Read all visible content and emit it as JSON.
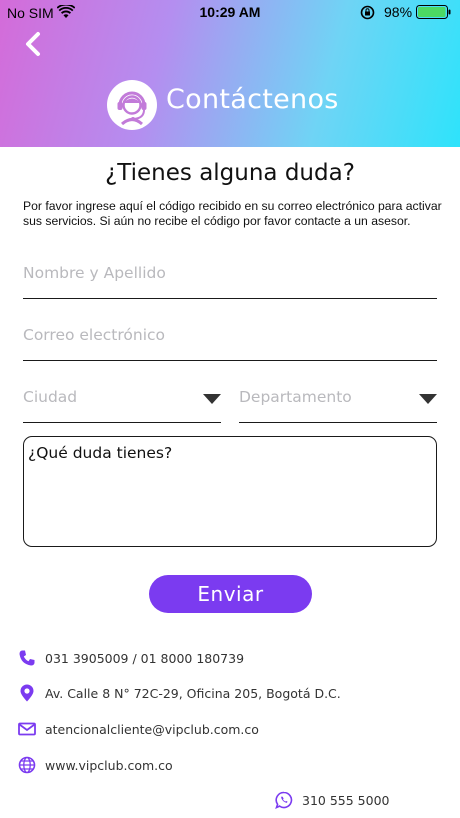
{
  "status_bar": {
    "carrier": "No SIM",
    "time": "10:29 AM",
    "battery": "98%"
  },
  "header": {
    "title": "Contáctenos",
    "gradient_colors": [
      "#d46bd9",
      "#b48ef0",
      "#6fd4f5",
      "#2ee3fb"
    ]
  },
  "main": {
    "title": "¿Tienes alguna duda?",
    "intro": "Por favor ingrese aquí el código recibido en su correo electrónico para activar sus servicios. Si aún no recibe el código por favor contacte a un asesor."
  },
  "form": {
    "name_placeholder": "Nombre y Apellido",
    "email_placeholder": "Correo electrónico",
    "city_placeholder": "Ciudad",
    "department_placeholder": "Departamento",
    "question_placeholder": "¿Qué duda tienes?",
    "submit_label": "Enviar",
    "accent_color": "#7b3bf0"
  },
  "contact": {
    "phone": "031 3905009 / 01 8000 180739",
    "address": "Av. Calle 8 N° 72C-29, Oficina 205, Bogotá D.C.",
    "email": "atencionalcliente@vipclub.com.co",
    "website": "www.vipclub.com.co",
    "whatsapp": "310 555 5000",
    "icon_color": "#7b3bf0"
  }
}
